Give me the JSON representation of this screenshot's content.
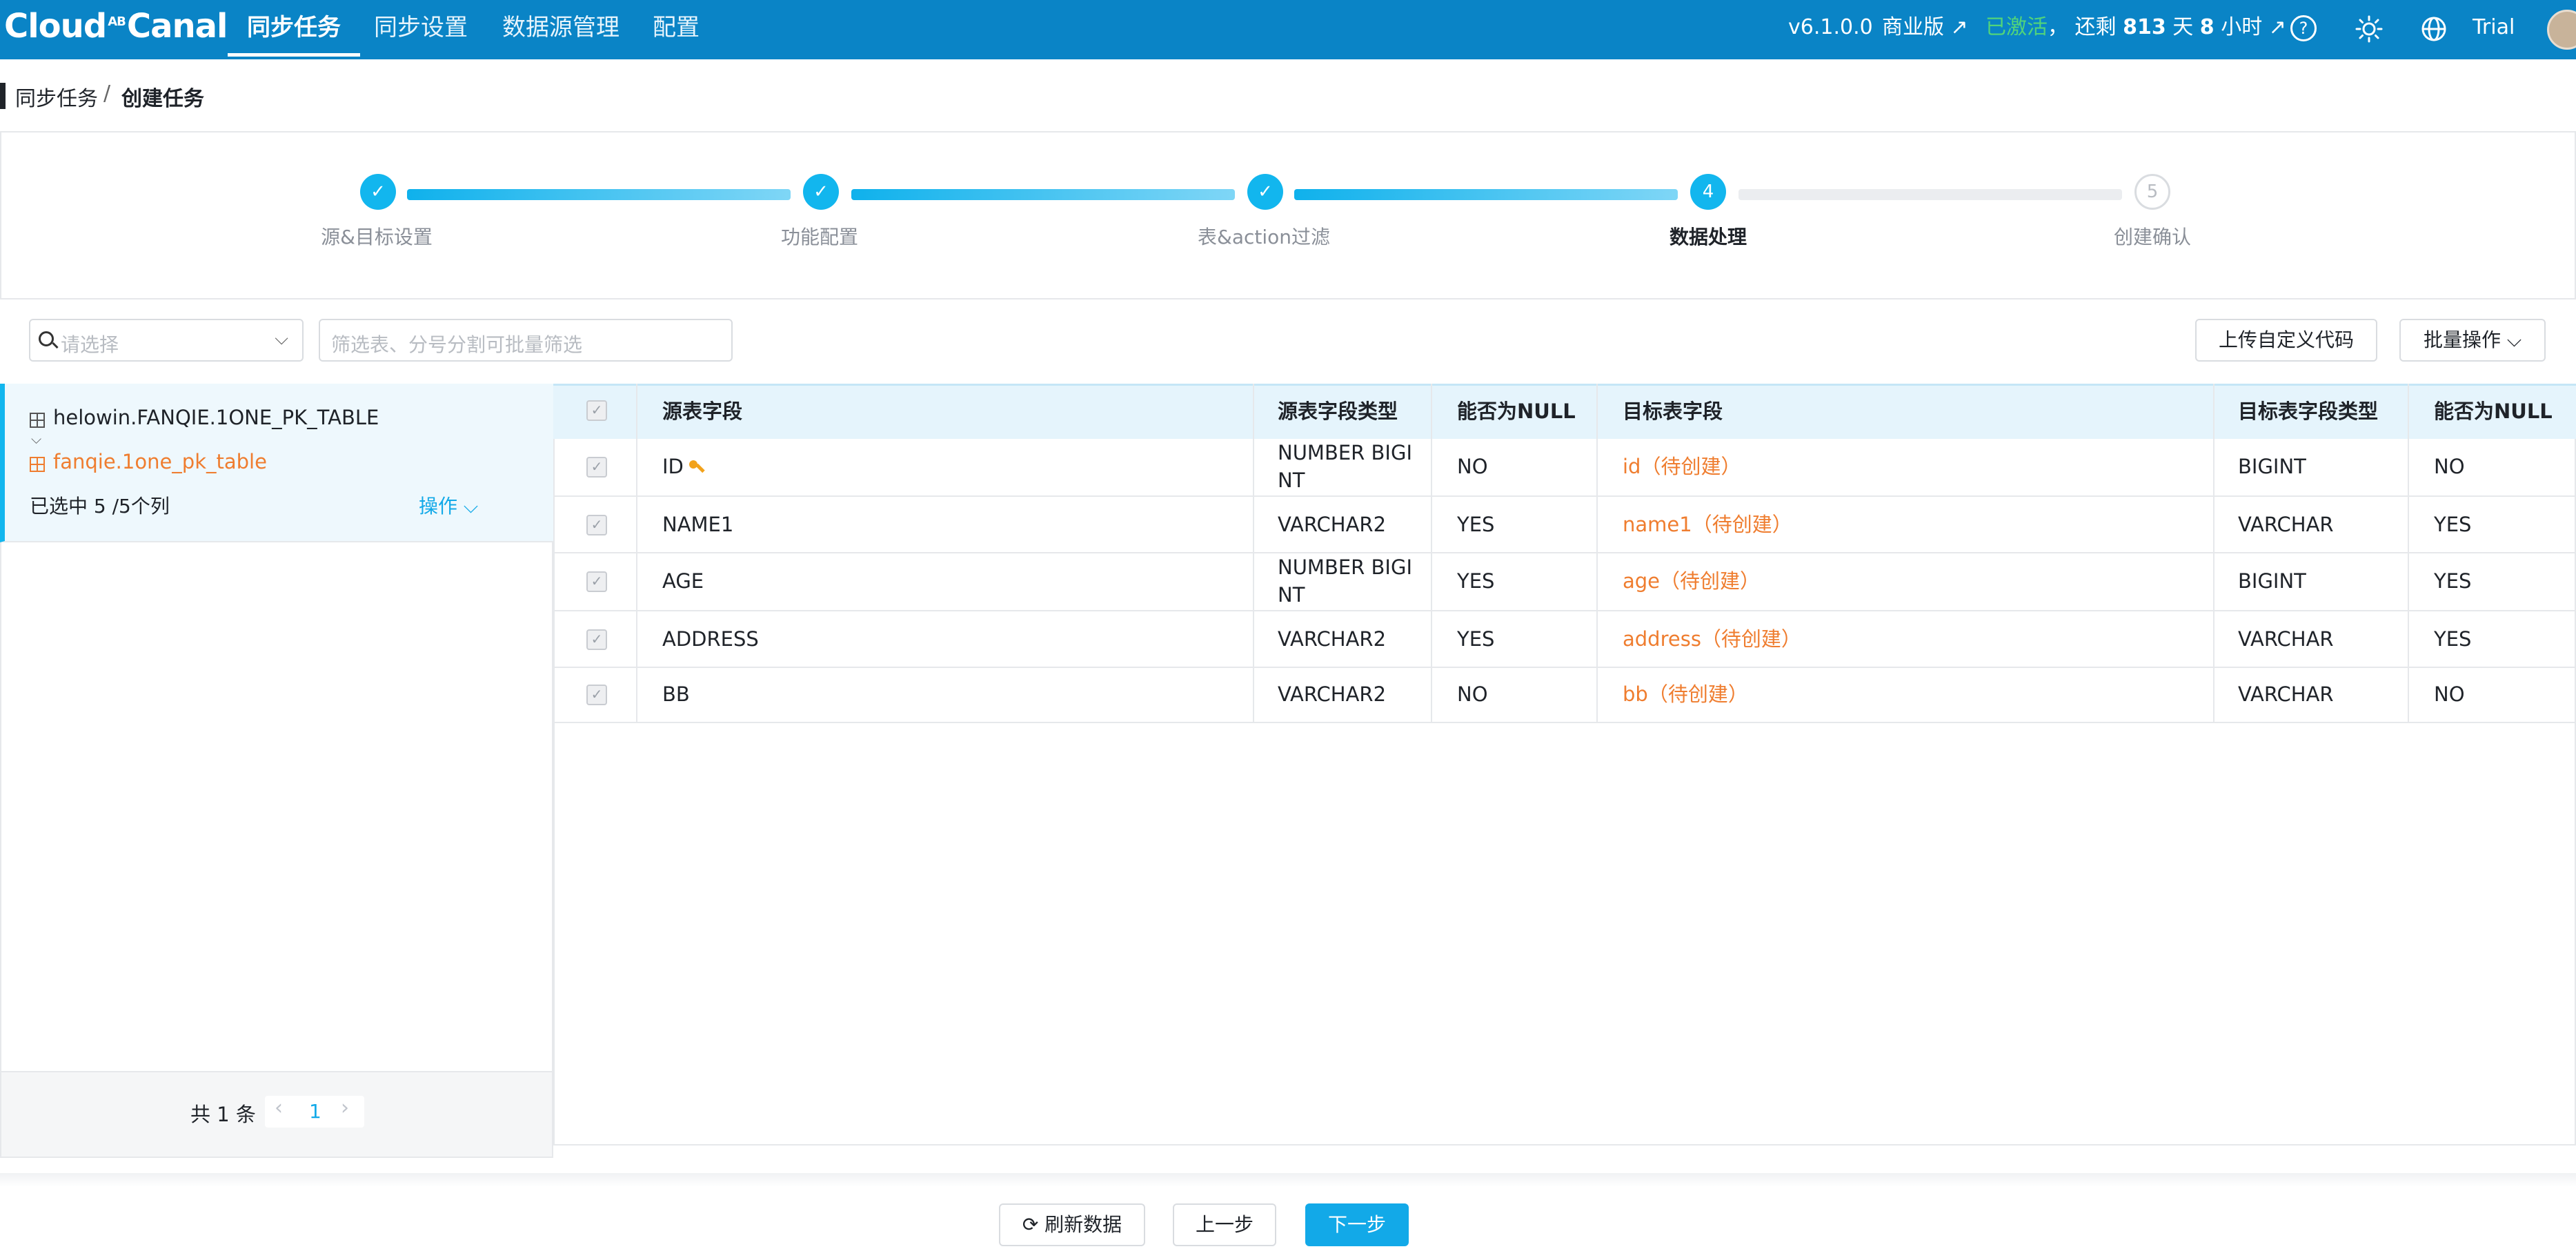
{
  "header": {
    "logo_main": "Cloud",
    "logo_small": "AB",
    "logo_tail": "Canal",
    "nav": [
      "同步任务",
      "同步设置",
      "数据源管理",
      "配置"
    ],
    "version": "v6.1.0.0",
    "edition": "商业版 ↗",
    "activated": "已激活",
    "remaining_prefix": "， 还剩 ",
    "remaining_days": "813",
    "days_unit": " 天 ",
    "remaining_hours": "8",
    "hours_unit": " 小时 ↗",
    "help_icon": "?",
    "user": "Trial"
  },
  "breadcrumb": {
    "parent": "同步任务",
    "separator": "/",
    "current": "创建任务"
  },
  "steps": [
    {
      "label": "源&目标设置",
      "mark": "✓",
      "state": "done"
    },
    {
      "label": "功能配置",
      "mark": "✓",
      "state": "done"
    },
    {
      "label": "表&action过滤",
      "mark": "✓",
      "state": "done"
    },
    {
      "label": "数据处理",
      "mark": "4",
      "state": "current"
    },
    {
      "label": "创建确认",
      "mark": "5",
      "state": "pending"
    }
  ],
  "filters": {
    "select_placeholder": "请选择",
    "table_filter_placeholder": "筛选表、分号分割可批量筛选",
    "upload_label": "上传自定义代码",
    "batch_label": "批量操作 ⌵"
  },
  "left": {
    "source_table": "helowin.FANQIE.1ONE_PK_TABLE",
    "expand_glyph": "⌵",
    "target_table": "fanqie.1one_pk_table",
    "selected": "已选中 5 /5个列",
    "action": "操作 ⌵",
    "total": "共 1 条",
    "prev": "‹",
    "page": "1",
    "next": "›"
  },
  "table": {
    "headers": [
      "源表字段",
      "源表字段类型",
      "能否为NULL",
      "目标表字段",
      "目标表字段类型",
      "能否为NULL"
    ],
    "check_mark": "✓",
    "rows": [
      {
        "src": "ID",
        "src_type_1": "NUMBER BIGI",
        "src_type_2": "NT",
        "null1": "NO",
        "dst": "id（待创建）",
        "dst_type": "BIGINT",
        "null2": "NO"
      },
      {
        "src": "NAME1",
        "src_type_1": "VARCHAR2",
        "src_type_2": "",
        "null1": "YES",
        "dst": "name1（待创建）",
        "dst_type": "VARCHAR",
        "null2": "YES"
      },
      {
        "src": "AGE",
        "src_type_1": "NUMBER BIGI",
        "src_type_2": "NT",
        "null1": "YES",
        "dst": "age（待创建）",
        "dst_type": "BIGINT",
        "null2": "YES"
      },
      {
        "src": "ADDRESS",
        "src_type_1": "VARCHAR2",
        "src_type_2": "",
        "null1": "YES",
        "dst": "address（待创建）",
        "dst_type": "VARCHAR",
        "null2": "YES"
      },
      {
        "src": "BB",
        "src_type_1": "VARCHAR2",
        "src_type_2": "",
        "null1": "NO",
        "dst": "bb（待创建）",
        "dst_type": "VARCHAR",
        "null2": "NO"
      }
    ]
  },
  "footer": {
    "refresh": "⟳ 刷新数据",
    "prev": "上一步",
    "next": "下一步"
  },
  "colors": {
    "brand": "#0a84c6",
    "accent": "#12b6ee",
    "orange": "#ef7d2f",
    "green": "#52d47a"
  }
}
